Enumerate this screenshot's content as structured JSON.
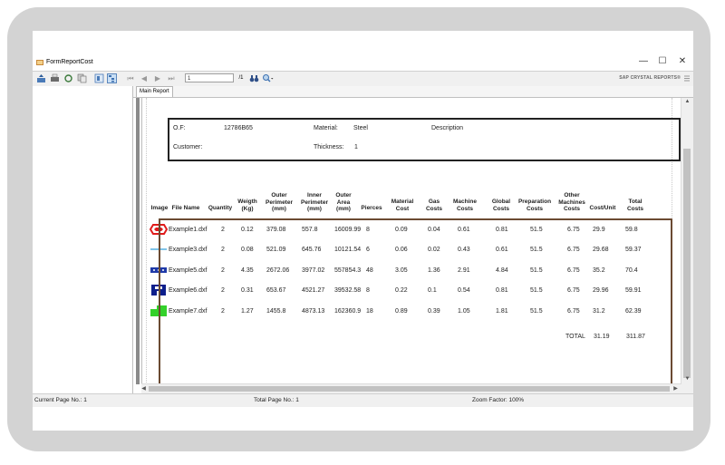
{
  "window": {
    "title": "FormReportCost",
    "controls": {
      "minimize": "—",
      "maximize": "☐",
      "close": "✕"
    }
  },
  "toolbar": {
    "nav": {
      "first": "⏮",
      "prev": "◀",
      "next": "▶",
      "last": "⏭"
    },
    "current_page": "1",
    "page_total": "/1",
    "brand": "SAP CRYSTAL REPORTS®"
  },
  "tabs": [
    "Main Report"
  ],
  "report": {
    "header": {
      "of_label": "O.F:",
      "of_value": "12786B65",
      "material_label": "Material:",
      "material_value": "Steel",
      "description_label": "Description",
      "customer_label": "Customer:",
      "thickness_label": "Thickness:",
      "thickness_value": "1"
    },
    "columns": [
      "Image",
      "File Name",
      "Quantity",
      "Weigth (Kg)",
      "Outer Perimeter (mm)",
      "Inner Perimeter (mm)",
      "Outer Area (mm)",
      "Pierces",
      "Material Cost",
      "Gas Costs",
      "Machine Costs",
      "Global Costs",
      "Preparation Costs",
      "Other Machines Costs",
      "Cost/Unit",
      "Total Costs"
    ],
    "rows": [
      {
        "image": "red-hexagon-part",
        "file": "Example1.dxf",
        "qty": "2",
        "weight": "0.12",
        "outer_perim": "379.08",
        "inner_perim": "557.8",
        "outer_area": "16009.99",
        "pierces": "8",
        "material_cost": "0.09",
        "gas": "0.04",
        "machine": "0.61",
        "global": "0.81",
        "prep": "51.5",
        "other": "6.75",
        "unit": "29.9",
        "total": "59.8"
      },
      {
        "image": "light-blue-strip-part",
        "file": "Example3.dxf",
        "qty": "2",
        "weight": "0.08",
        "outer_perim": "521.09",
        "inner_perim": "645.76",
        "outer_area": "10121.54",
        "pierces": "6",
        "material_cost": "0.06",
        "gas": "0.02",
        "machine": "0.43",
        "global": "0.61",
        "prep": "51.5",
        "other": "6.75",
        "unit": "29.68",
        "total": "59.37"
      },
      {
        "image": "blue-bar-part",
        "file": "Example5.dxf",
        "qty": "2",
        "weight": "4.35",
        "outer_perim": "2672.06",
        "inner_perim": "3977.02",
        "outer_area": "557854.3",
        "pierces": "48",
        "material_cost": "3.05",
        "gas": "1.36",
        "machine": "2.91",
        "global": "4.84",
        "prep": "51.5",
        "other": "6.75",
        "unit": "35.2",
        "total": "70.4"
      },
      {
        "image": "navy-bracket-part",
        "file": "Example6.dxf",
        "qty": "2",
        "weight": "0.31",
        "outer_perim": "653.67",
        "inner_perim": "4521.27",
        "outer_area": "39532.58",
        "pierces": "8",
        "material_cost": "0.22",
        "gas": "0.1",
        "machine": "0.54",
        "global": "0.81",
        "prep": "51.5",
        "other": "6.75",
        "unit": "29.96",
        "total": "59.91"
      },
      {
        "image": "green-block-part",
        "file": "Example7.dxf",
        "qty": "2",
        "weight": "1.27",
        "outer_perim": "1455.8",
        "inner_perim": "4873.13",
        "outer_area": "162360.9",
        "pierces": "18",
        "material_cost": "0.89",
        "gas": "0.39",
        "machine": "1.05",
        "global": "1.81",
        "prep": "51.5",
        "other": "6.75",
        "unit": "31.2",
        "total": "62.39"
      }
    ],
    "totals": {
      "label": "TOTAL",
      "unit": "31.19",
      "total": "311.87"
    }
  },
  "statusbar": {
    "current_page": "Current Page No.: 1",
    "total_page": "Total Page No.: 1",
    "zoom": "Zoom Factor: 100%"
  }
}
